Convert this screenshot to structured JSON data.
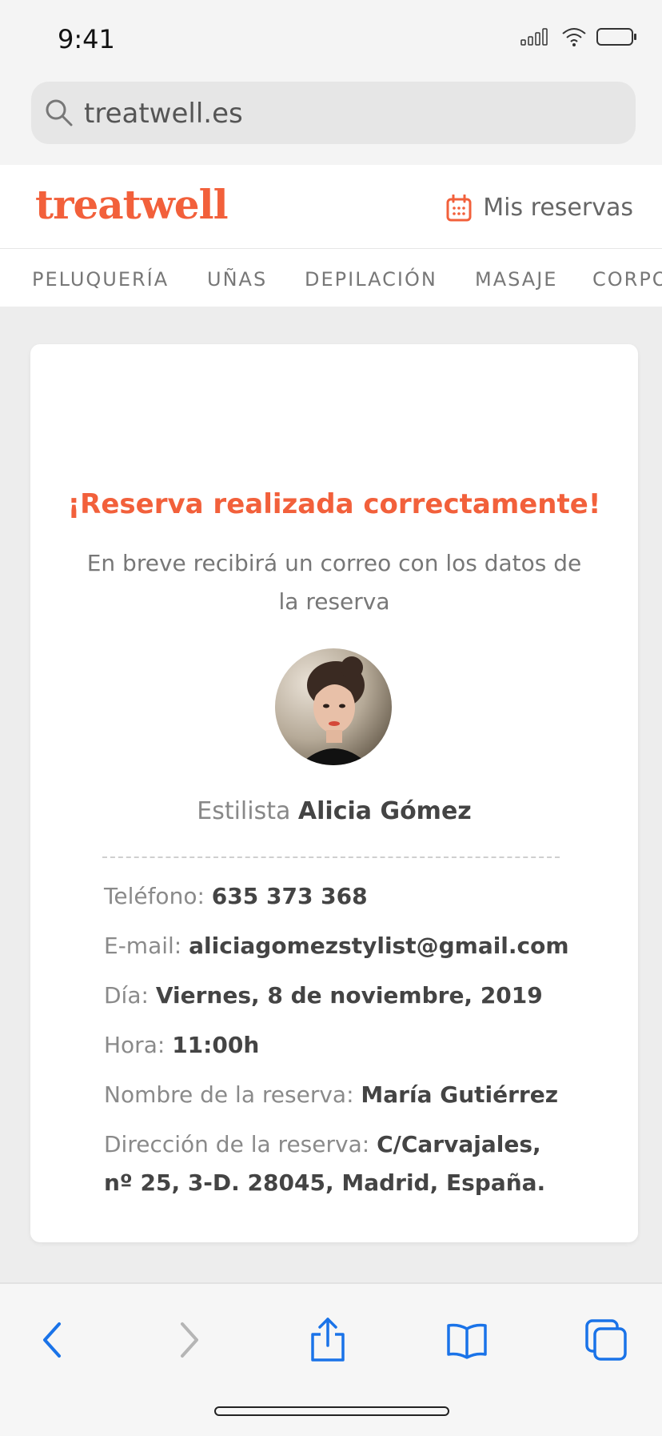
{
  "status": {
    "time": "9:41"
  },
  "browser": {
    "url": "treatwell.es"
  },
  "header": {
    "logo": "treatwell",
    "reservations_label": "Mis reservas"
  },
  "categories": [
    "PELUQUERÍA",
    "UÑAS",
    "DEPILACIÓN",
    "MASAJE",
    "CORPO"
  ],
  "confirmation": {
    "title": "¡Reserva realizada correctamente!",
    "subtitle": "En breve recibirá un correo con los datos de la reserva",
    "stylist_label": "Estilista ",
    "stylist_name": "Alicia Gómez",
    "phone_label": "Teléfono: ",
    "phone": "635 373 368",
    "email_label": "E-mail: ",
    "email": "aliciagomezstylist@gmail.com",
    "day_label": "Día: ",
    "day": "Viernes, 8 de noviembre, 2019",
    "time_label": "Hora: ",
    "time": "11:00h",
    "name_label": "Nombre de la reserva: ",
    "name": "María Gutiérrez",
    "address_label": "Dirección de la reserva: ",
    "address": "C/Carvajales, nº 25, 3-D. 28045, Madrid, España."
  },
  "toolbar": {
    "icons": [
      "back-icon",
      "forward-icon",
      "share-icon",
      "bookmarks-icon",
      "tabs-icon"
    ]
  },
  "colors": {
    "brand": "#f2603b",
    "ios_blue": "#1a73e8"
  }
}
